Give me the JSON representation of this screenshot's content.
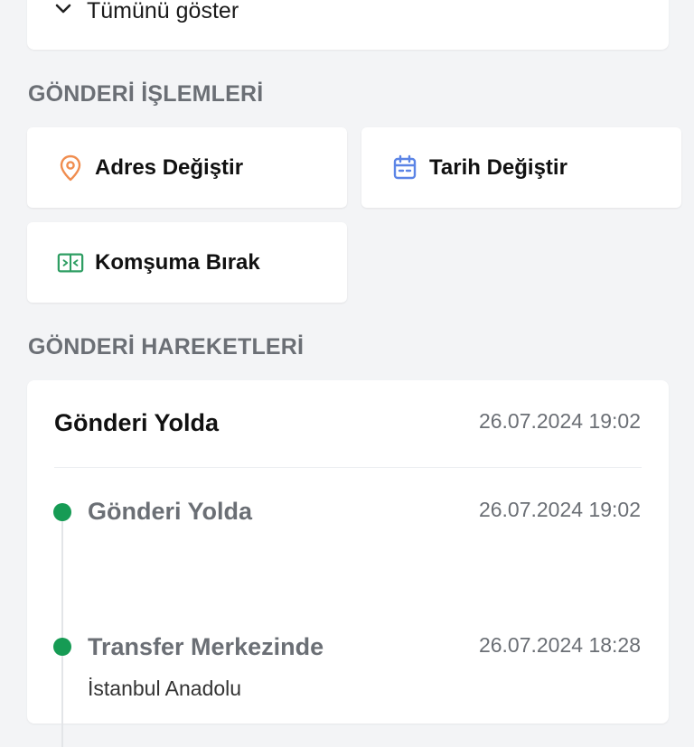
{
  "show_all": {
    "label": "Tümünü göster"
  },
  "operations": {
    "title": "GÖNDERİ İŞLEMLERİ",
    "items": [
      {
        "label": "Adres Değiştir",
        "icon": "location-pin-icon",
        "color": "#f08d4f"
      },
      {
        "label": "Tarih Değiştir",
        "icon": "calendar-icon",
        "color": "#5b84e6"
      },
      {
        "label": "Komşuma Bırak",
        "icon": "neighbor-transfer-icon",
        "color": "#2f9e63"
      }
    ]
  },
  "movements": {
    "title": "GÖNDERİ HAREKETLERİ",
    "current_status": "Gönderi Yolda",
    "current_date": "26.07.2024 19:02",
    "events": [
      {
        "title": "Gönderi Yolda",
        "date": "26.07.2024 19:02",
        "subtitle": ""
      },
      {
        "title": "Transfer Merkezinde",
        "date": "26.07.2024 18:28",
        "subtitle": "İstanbul Anadolu"
      }
    ],
    "dot_color": "#169b54"
  }
}
